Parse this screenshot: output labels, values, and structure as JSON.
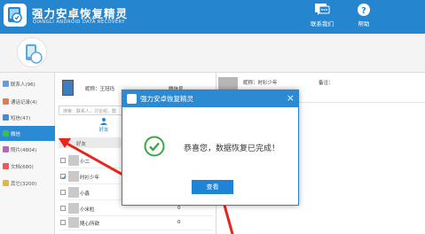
{
  "titlebar": {
    "title": "强力安卓恢复精灵",
    "subtitle": "QIANGLI ANDROID DATA RECOVERY",
    "contact_label": "联系我们",
    "help_label": "帮助",
    "colors": {
      "bar": "#2586cf"
    }
  },
  "sidebar": {
    "items": [
      {
        "label": "联系人(96)",
        "icon": "contacts-icon",
        "color": "#5aa0e6"
      },
      {
        "label": "通话记录(4)",
        "icon": "call-log-icon",
        "color": "#e67a4a"
      },
      {
        "label": "短信(47)",
        "icon": "sms-icon",
        "color": "#3a8fe0"
      },
      {
        "label": "微信",
        "icon": "wechat-icon",
        "color": "#3fbf3f",
        "active": true
      },
      {
        "label": "照片(4804)",
        "icon": "photos-icon",
        "color": "#c55cc5"
      },
      {
        "label": "文档(680)",
        "icon": "documents-icon",
        "color": "#e85c5c"
      },
      {
        "label": "其它(3200)",
        "icon": "other-icon",
        "color": "#e6b53a"
      }
    ]
  },
  "contact_panel": {
    "nickname": "昵称：王冠玛",
    "wechat_id": "微信号",
    "search_placeholder": "搜索：联系人，讨论组，群",
    "tab_friends": "好友",
    "column_header": "好友",
    "rows": [
      {
        "name": "小二",
        "count": ""
      },
      {
        "name": "时衫少年",
        "count": "",
        "checked": true
      },
      {
        "name": "小鑫",
        "count": ""
      },
      {
        "name": "小米粒",
        "count": "0"
      },
      {
        "name": "随心所欲",
        "count": "0"
      }
    ]
  },
  "right_panel": {
    "nickname": "昵称：时衫少年",
    "remark": "备注："
  },
  "dialog": {
    "title": "强力安卓恢复精灵",
    "message": "恭喜您，数据恢复已完成！",
    "view_button": "查看",
    "close": "×"
  }
}
